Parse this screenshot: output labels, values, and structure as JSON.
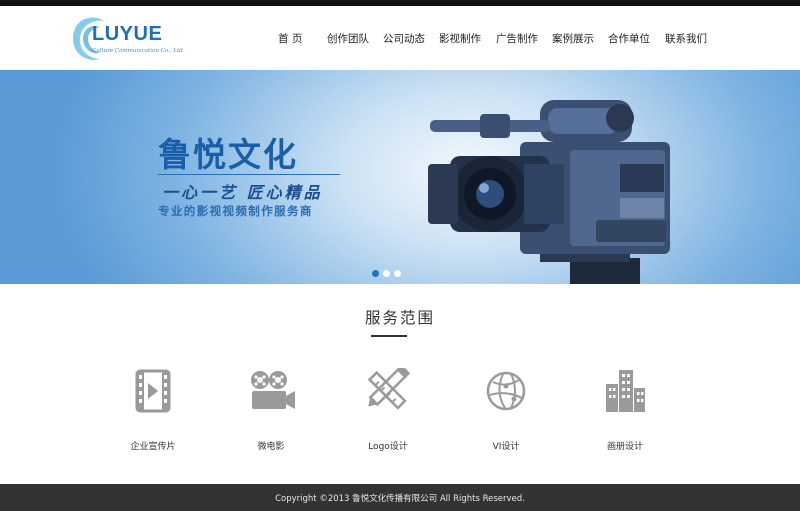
{
  "header": {
    "logo": {
      "brand": "LUYUE",
      "tagline": "Culture Communication Co., Ltd"
    },
    "nav": [
      {
        "label": "首 页"
      },
      {
        "label": "创作团队"
      },
      {
        "label": "公司动态"
      },
      {
        "label": "影视制作"
      },
      {
        "label": "广告制作"
      },
      {
        "label": "案例展示"
      },
      {
        "label": "合作单位"
      },
      {
        "label": "联系我们"
      }
    ]
  },
  "banner": {
    "title": "鲁悦文化",
    "slogan": "一心一艺  匠心精品",
    "subtitle": "专业的影视视频制作服务商",
    "image_icon": "video-camera-icon",
    "slides": {
      "count": 3,
      "active_index": 1
    }
  },
  "services": {
    "title": "服务范围",
    "items": [
      {
        "label": "企业宣传片",
        "icon": "film-play-icon"
      },
      {
        "label": "微电影",
        "icon": "movie-projector-icon"
      },
      {
        "label": "Logo设计",
        "icon": "pencil-ruler-icon"
      },
      {
        "label": "VI设计",
        "icon": "globe-icon"
      },
      {
        "label": "画册设计",
        "icon": "buildings-icon"
      }
    ]
  },
  "footer": {
    "copyright": "Copyright ©2013 鲁悦文化传播有限公司 All Rights Reserved."
  },
  "colors": {
    "brand": "#1d6fb8",
    "dark": "#333333",
    "icon_gray": "#9a9a9a",
    "active_dot": "#1f73c4"
  }
}
